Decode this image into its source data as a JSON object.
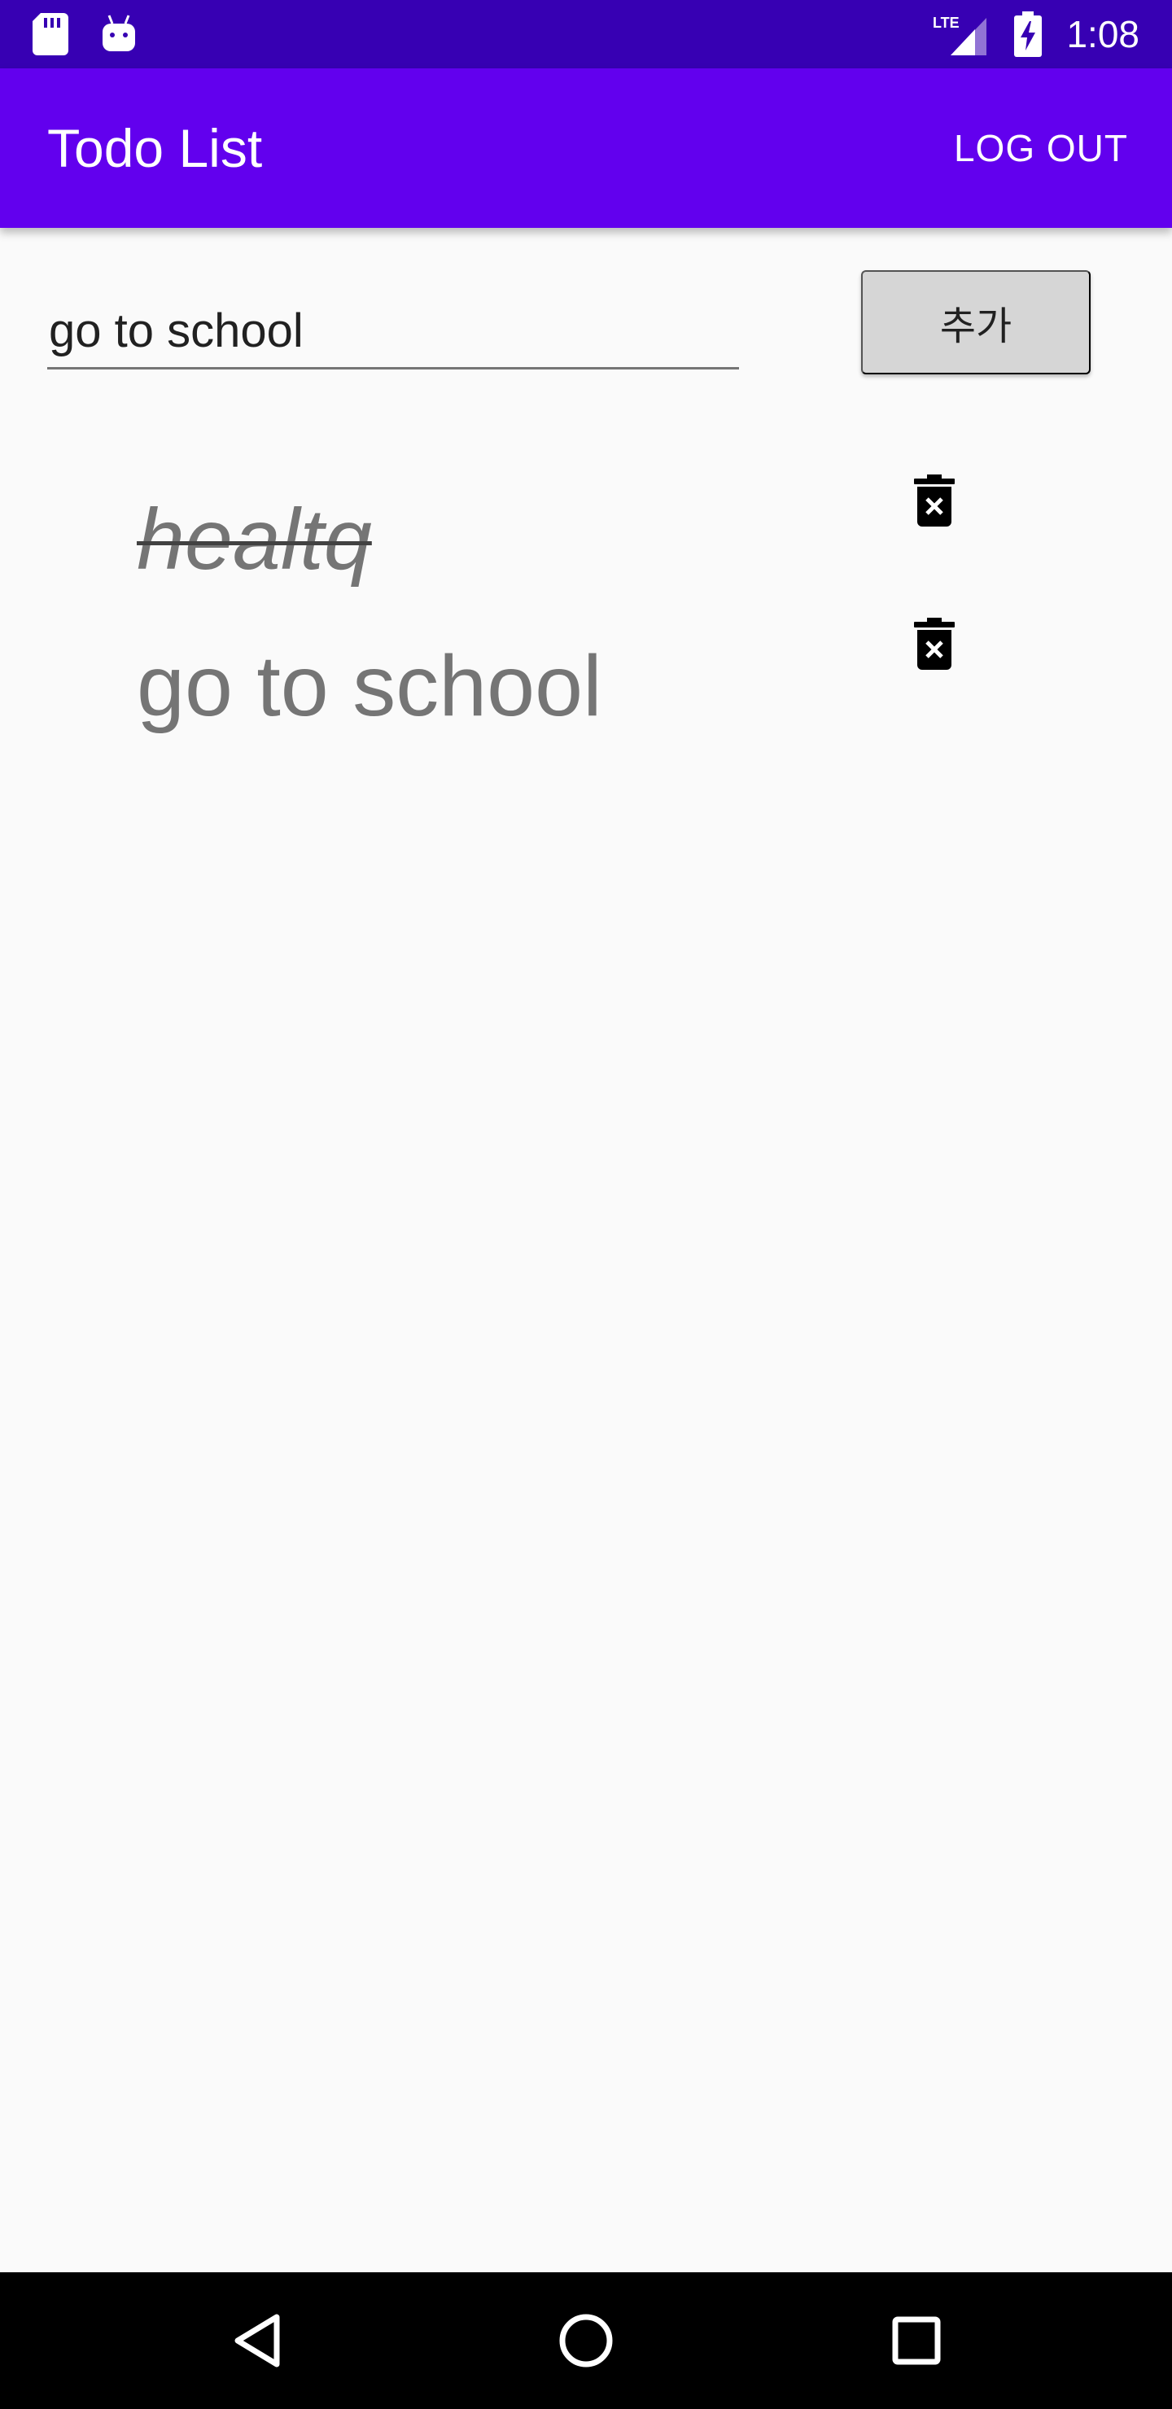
{
  "status_bar": {
    "time": "1:08",
    "network_label": "LTE",
    "icons": [
      "sd-card-icon",
      "android-icon",
      "signal-icon",
      "battery-charging-icon"
    ]
  },
  "app_bar": {
    "title": "Todo List",
    "logout_label": "LOG OUT"
  },
  "input": {
    "value": "go to school"
  },
  "add_button": {
    "label": "추가"
  },
  "todos": [
    {
      "text": "healtq",
      "completed": true
    },
    {
      "text": "go to school",
      "completed": false
    }
  ],
  "nav_bar": {
    "icons": [
      "back-icon",
      "home-icon",
      "recents-icon"
    ]
  },
  "colors": {
    "status_bar": "#3700b3",
    "app_bar": "#6200ee",
    "background": "#fafafa",
    "button": "#d6d6d6",
    "todo_text": "#757575"
  }
}
